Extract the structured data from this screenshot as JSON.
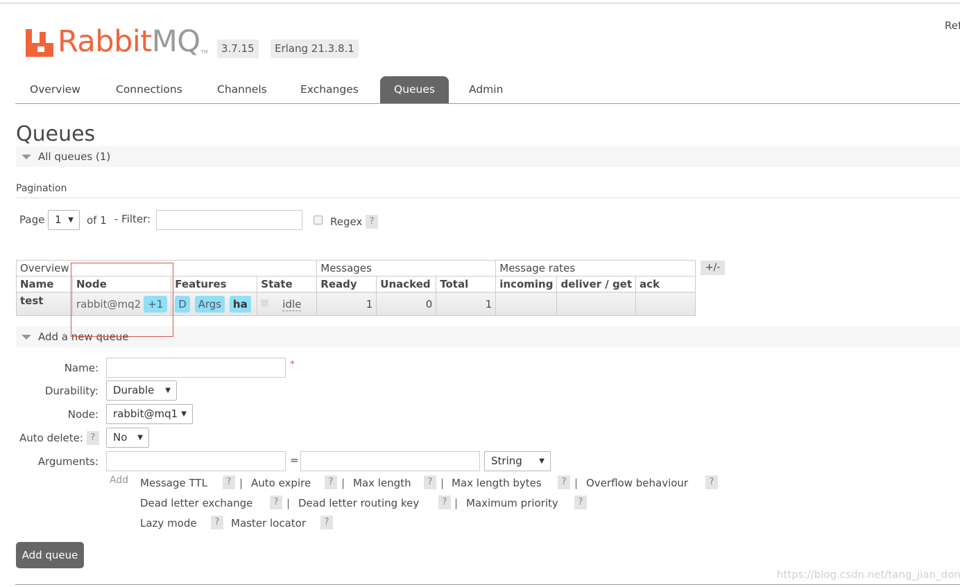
{
  "header": {
    "logo_brand": "Rabbit",
    "logo_mq": "MQ",
    "logo_tm": "TM",
    "version": "3.7.15",
    "erlang": "Erlang 21.3.8.1",
    "refresh_label": "Refreshed"
  },
  "tabs": [
    {
      "label": "Overview"
    },
    {
      "label": "Connections"
    },
    {
      "label": "Channels"
    },
    {
      "label": "Exchanges"
    },
    {
      "label": "Queues"
    },
    {
      "label": "Admin"
    }
  ],
  "page_title": "Queues",
  "all_queues": {
    "label": "All queues (1)"
  },
  "pagination": {
    "label": "Pagination",
    "page_label": "Page",
    "page_value": "1",
    "of_label": "of 1",
    "filter_label": "- Filter:",
    "filter_value": "",
    "regex_label": "Regex",
    "help": "?"
  },
  "table": {
    "groups": {
      "overview": "Overview",
      "messages": "Messages",
      "rates": "Message rates"
    },
    "columns": {
      "name": "Name",
      "node": "Node",
      "features": "Features",
      "state": "State",
      "ready": "Ready",
      "unacked": "Unacked",
      "total": "Total",
      "incoming": "incoming",
      "deliver_get": "deliver / get",
      "ack": "ack"
    },
    "toggle_label": "+/-",
    "rows": [
      {
        "name": "test",
        "node": "rabbit@mq2",
        "node_extra": "+1",
        "features": [
          "D",
          "Args",
          "ha"
        ],
        "state": "idle",
        "ready": "1",
        "unacked": "0",
        "total": "1",
        "incoming": "",
        "deliver_get": "",
        "ack": ""
      }
    ]
  },
  "add_queue": {
    "section_label": "Add a new queue",
    "name_label": "Name:",
    "name_value": "",
    "required_mark": "*",
    "durability_label": "Durability:",
    "durability_value": "Durable",
    "node_label": "Node:",
    "node_value": "rabbit@mq1",
    "auto_delete_label": "Auto delete:",
    "auto_delete_value": "No",
    "arguments_label": "Arguments:",
    "equals": "=",
    "arg_type_value": "String",
    "add_hint": "Add",
    "arg_links": [
      "Message TTL",
      "Auto expire",
      "Max length",
      "Max length bytes",
      "Overflow behaviour",
      "Dead letter exchange",
      "Dead letter routing key",
      "Maximum priority",
      "Lazy mode",
      "Master locator"
    ],
    "separator": "|",
    "help": "?",
    "submit_label": "Add queue"
  },
  "watermark": "https://blog.csdn.net/tang_jian_dong",
  "colors": {
    "brand_orange": "#f0643c",
    "active_tab": "#666666",
    "feature_pill": "#8fdff5",
    "highlight_box": "#d9534f"
  }
}
